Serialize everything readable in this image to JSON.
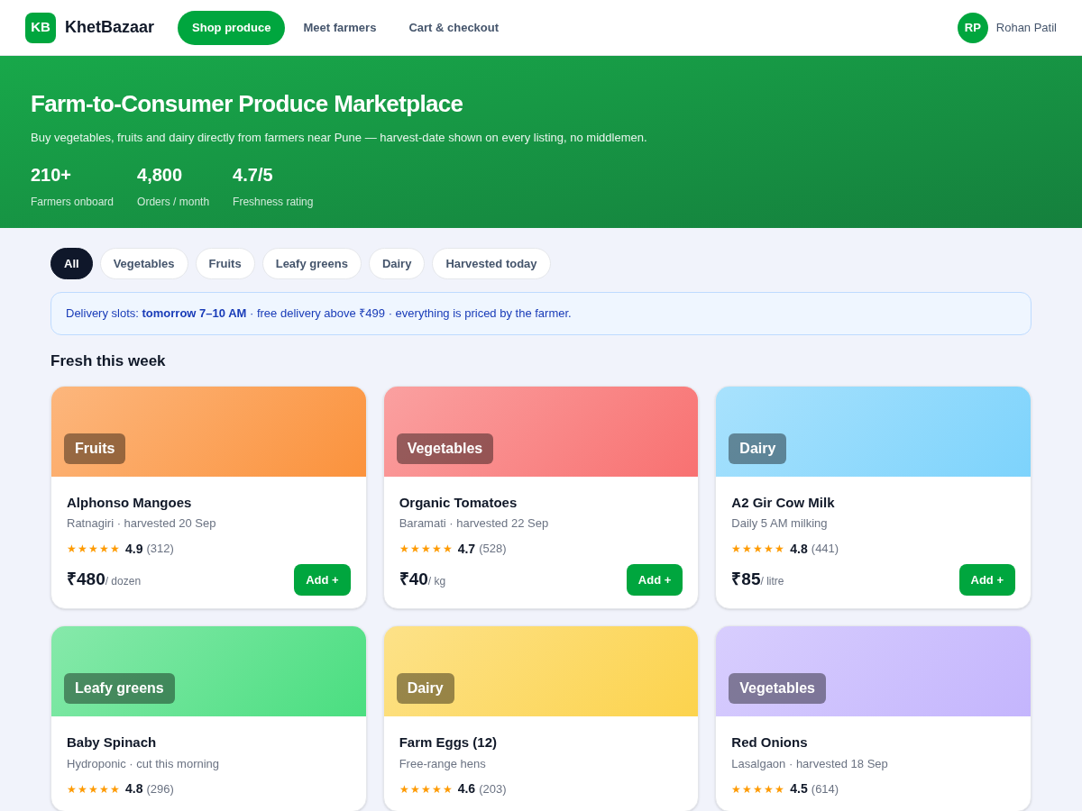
{
  "brand": {
    "logo": "KB",
    "name": "KhetBazaar"
  },
  "nav": [
    {
      "label": "Shop produce",
      "selected": true
    },
    {
      "label": "Meet farmers",
      "selected": false
    },
    {
      "label": "Cart & checkout",
      "selected": false
    }
  ],
  "user": {
    "initials": "RP",
    "name": "Rohan Patil"
  },
  "hero": {
    "title": "Farm-to-Consumer Produce Marketplace",
    "subtitle": "Buy vegetables, fruits and dairy directly from farmers near Pune — harvest-date shown on every listing, no middlemen.",
    "stats": [
      {
        "value": "210+",
        "label": "Farmers onboard"
      },
      {
        "value": "4,800",
        "label": "Orders / month"
      },
      {
        "value": "4.7/5",
        "label": "Freshness rating"
      }
    ]
  },
  "filters": [
    {
      "label": "All",
      "selected": true
    },
    {
      "label": "Vegetables",
      "selected": false
    },
    {
      "label": "Fruits",
      "selected": false
    },
    {
      "label": "Leafy greens",
      "selected": false
    },
    {
      "label": "Dairy",
      "selected": false
    },
    {
      "label": "Harvested today",
      "selected": false
    }
  ],
  "notice": "Delivery slots: **tomorrow 7–10 AM** · free delivery above ₹499 · everything is priced by the farmer.",
  "section_title": "Fresh this week",
  "products": [
    {
      "category": "Fruits",
      "color": "#fb923c",
      "name": "Alphonso Mangoes",
      "meta": "Ratnagiri · harvested 20 Sep",
      "stars": 5,
      "rating": "4.9",
      "reviews": "(312)",
      "price": "₹480",
      "unit": "/ dozen",
      "button": "Add +"
    },
    {
      "category": "Vegetables",
      "color": "#f87171",
      "name": "Organic Tomatoes",
      "meta": "Baramati · harvested 22 Sep",
      "stars": 5,
      "rating": "4.7",
      "reviews": "(528)",
      "price": "₹40",
      "unit": "/ kg",
      "button": "Add +"
    },
    {
      "category": "Dairy",
      "color": "#7dd3fc",
      "name": "A2 Gir Cow Milk",
      "meta": "Daily 5 AM milking",
      "stars": 5,
      "rating": "4.8",
      "reviews": "(441)",
      "price": "₹85",
      "unit": "/ litre",
      "button": "Add +"
    },
    {
      "category": "Leafy greens",
      "color": "#4ade80",
      "name": "Baby Spinach",
      "meta": "Hydroponic · cut this morning",
      "stars": 5,
      "rating": "4.8",
      "reviews": "(296)"
    },
    {
      "category": "Dairy",
      "color": "#fcd34d",
      "name": "Farm Eggs (12)",
      "meta": "Free-range hens",
      "stars": 5,
      "rating": "4.6",
      "reviews": "(203)"
    },
    {
      "category": "Vegetables",
      "color": "#c4b5fd",
      "name": "Red Onions",
      "meta": "Lasalgaon · harvested 18 Sep",
      "stars": 5,
      "rating": "4.5",
      "reviews": "(614)"
    }
  ]
}
